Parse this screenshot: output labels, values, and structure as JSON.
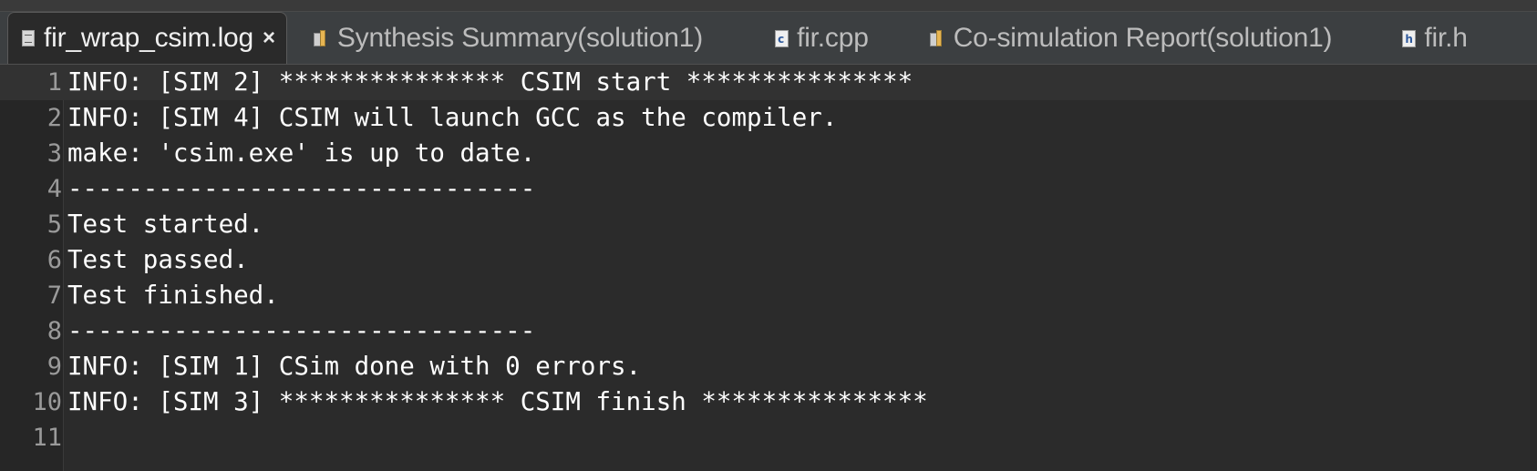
{
  "tabs": [
    {
      "label": "fir_wrap_csim.log",
      "icon": "log-file-icon",
      "active": true,
      "close_label": "×"
    },
    {
      "label": "Synthesis Summary(solution1)",
      "icon": "report-icon",
      "active": false
    },
    {
      "label": "fir.cpp",
      "icon": "c-source-file-icon",
      "active": false,
      "icon_letter": "c"
    },
    {
      "label": "Co-simulation Report(solution1)",
      "icon": "report-icon",
      "active": false
    },
    {
      "label": "fir.h",
      "icon": "header-file-icon",
      "active": false,
      "icon_letter": "h"
    }
  ],
  "editor": {
    "lines": [
      {
        "num": "1",
        "text": "INFO: [SIM 2] *************** CSIM start ***************"
      },
      {
        "num": "2",
        "text": "INFO: [SIM 4] CSIM will launch GCC as the compiler."
      },
      {
        "num": "3",
        "text": "make: 'csim.exe' is up to date."
      },
      {
        "num": "4",
        "text": "-------------------------------"
      },
      {
        "num": "5",
        "text": "Test started."
      },
      {
        "num": "6",
        "text": "Test passed."
      },
      {
        "num": "7",
        "text": "Test finished."
      },
      {
        "num": "8",
        "text": "-------------------------------"
      },
      {
        "num": "9",
        "text": "INFO: [SIM 1] CSim done with 0 errors."
      },
      {
        "num": "10",
        "text": "INFO: [SIM 3] *************** CSIM finish ***************"
      },
      {
        "num": "11",
        "text": ""
      }
    ]
  },
  "colors": {
    "background": "#2b2b2b",
    "tabbar": "#3c3f41",
    "active_tab": "#2a2a2a",
    "text": "#ffffff",
    "line_numbers": "#9a9a9a"
  }
}
